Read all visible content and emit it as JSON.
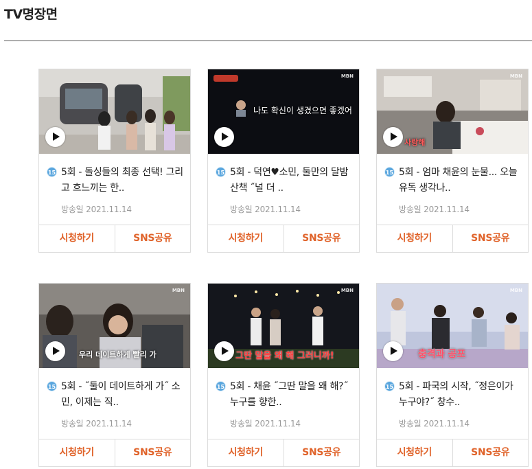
{
  "page": {
    "title": "TV명장면"
  },
  "clips": [
    {
      "badge": "15",
      "title": "5회 - 돌싱들의 최종 선택! 그리고 흐느끼는 한..",
      "airdate": "방송일 2021.11.14",
      "watch_label": "시청하기",
      "share_label": "SNS공유",
      "overlay": "",
      "broadcaster": ""
    },
    {
      "badge": "15",
      "title": "5회 - 덕연♥소민, 둘만의 달밤 산책 ˝널 더 ..",
      "airdate": "방송일 2021.11.14",
      "watch_label": "시청하기",
      "share_label": "SNS공유",
      "overlay": "나도 확신이 생겼으면 좋겠어",
      "broadcaster": "MBN"
    },
    {
      "badge": "15",
      "title": "5회 - 엄마 채윤의 눈물... 오늘 유독 생각나..",
      "airdate": "방송일 2021.11.14",
      "watch_label": "시청하기",
      "share_label": "SNS공유",
      "overlay": "사랑해",
      "broadcaster": "MBN"
    },
    {
      "badge": "15",
      "title": "5회 - ˝둘이 데이트하게 가˝ 소민, 이제는 직..",
      "airdate": "방송일 2021.11.14",
      "watch_label": "시청하기",
      "share_label": "SNS공유",
      "overlay": "우리 데이트하게 빨리 가",
      "broadcaster": "MBN"
    },
    {
      "badge": "15",
      "title": "5회 - 채윤 ˝그딴 말을 왜 해?˝ 누구를 향한..",
      "airdate": "방송일 2021.11.14",
      "watch_label": "시청하기",
      "share_label": "SNS공유",
      "overlay": "그딴 말을 왜 해 그러니까!",
      "broadcaster": "MBN"
    },
    {
      "badge": "15",
      "title": "5회 - 파국의 시작, ˝정은이가 누구야?˝ 창수..",
      "airdate": "방송일 2021.11.14",
      "watch_label": "시청하기",
      "share_label": "SNS공유",
      "overlay": "충격과 공포",
      "broadcaster": "MBN"
    }
  ]
}
